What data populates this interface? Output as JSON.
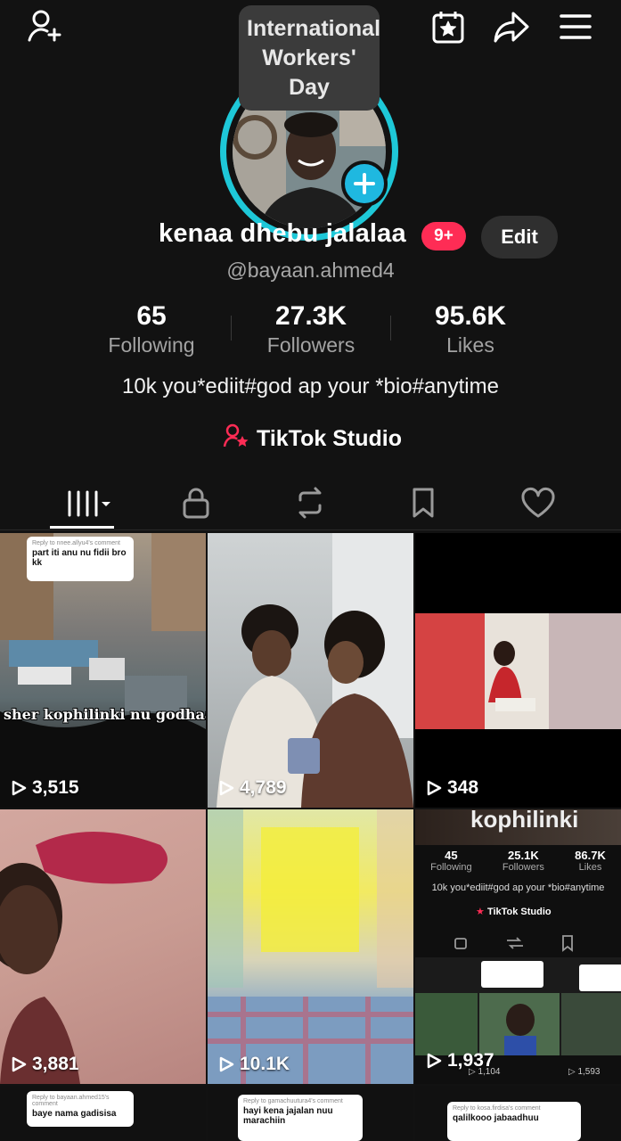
{
  "header": {
    "tooltip": "International Workers' Day",
    "icons": [
      "add-friend-icon",
      "calendar-star-icon",
      "share-icon",
      "menu-icon"
    ]
  },
  "profile": {
    "name": "kenaa dhebu jalalaa",
    "notification_badge": "9+",
    "edit_label": "Edit",
    "handle": "@bayaan.ahmed4",
    "bio": "10k you*ediit#god ap your *bio#anytime",
    "studio_label": "TikTok Studio",
    "accent_color": "#1ec8d8"
  },
  "stats": [
    {
      "value": "65",
      "label": "Following"
    },
    {
      "value": "27.3K",
      "label": "Followers"
    },
    {
      "value": "95.6K",
      "label": "Likes"
    }
  ],
  "tabs": [
    "videos-grid",
    "private",
    "reposts",
    "favorites",
    "liked"
  ],
  "videos": [
    {
      "views": "3,515",
      "comment_reply": "Reply to nnee.allyu4's comment",
      "comment_text": "part iti anu nu fidii bro kk",
      "overlay": "sher kophilinki nu godhaa"
    },
    {
      "views": "4,789"
    },
    {
      "views": "348"
    },
    {
      "views": "3,881"
    },
    {
      "views": "10.1K"
    },
    {
      "views": "1,937",
      "overlay": "kophilinki",
      "mini_stats": [
        {
          "value": "45",
          "label": "Following"
        },
        {
          "value": "25.1K",
          "label": "Followers"
        },
        {
          "value": "86.7K",
          "label": "Likes"
        }
      ],
      "mini_bio": "10k you*ediit#god ap your *bio#anytime",
      "mini_studio": "TikTok Studio",
      "mini_views": [
        "1,104",
        "1,593"
      ]
    },
    {
      "comment_reply": "Reply to bayaan.ahmed15's comment",
      "comment_text": "baye nama gadisisa"
    },
    {
      "comment_reply": "Reply to gamachuutura4's comment",
      "comment_text": "hayi kena jajalan nuu marachiin"
    },
    {
      "comment_reply": "Reply to kosa.firdisa's comment",
      "comment_text": "qalilkooo jabaadhuu"
    }
  ]
}
